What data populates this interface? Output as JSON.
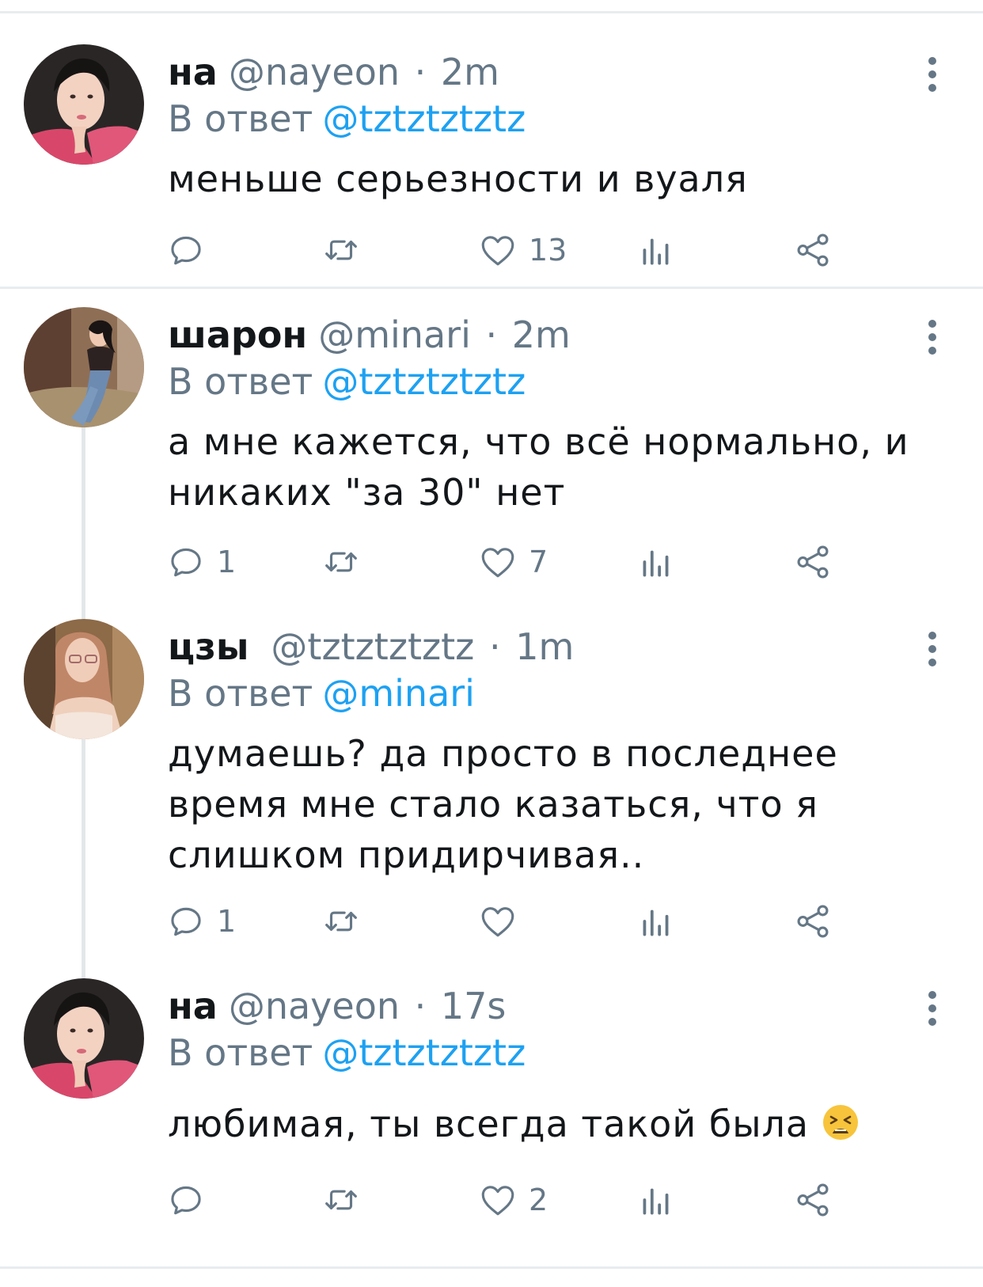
{
  "colors": {
    "accent": "#1da1f2",
    "secondary": "#657786",
    "text": "#14171a",
    "separator": "#e8ecef"
  },
  "tweets": [
    {
      "name": "на",
      "handle": "@nayeon",
      "dot": "·",
      "time": "2m",
      "reply_prefix": "В ответ",
      "reply_to": "@tztztztztz",
      "lines": [
        "меньше серьезности и вуаля"
      ],
      "reply_count": "",
      "retweet_count": "",
      "like_count": "13",
      "icons": {
        "reply": "reply-icon",
        "retweet": "retweet-icon",
        "like": "heart-icon",
        "stats": "analytics-icon",
        "share": "share-icon",
        "more": "more-vertical-icon"
      }
    },
    {
      "name": "шарон",
      "handle": "@minari",
      "dot": "·",
      "time": "2m",
      "reply_prefix": "В ответ",
      "reply_to": "@tztztztztz",
      "lines": [
        "а мне кажется, что всё нормально, и",
        "никаких \"за 30\" нет"
      ],
      "reply_count": "1",
      "retweet_count": "",
      "like_count": "7"
    },
    {
      "name": "цзы",
      "handle": "@tztztztztz",
      "dot": "·",
      "time": "1m",
      "reply_prefix": "В ответ",
      "reply_to": "@minari",
      "lines": [
        "думаешь? да просто в последнее",
        "время мне стало казаться, что я",
        "слишком придирчивая.."
      ],
      "reply_count": "1",
      "retweet_count": "",
      "like_count": ""
    },
    {
      "name": "на",
      "handle": "@nayeon",
      "dot": "·",
      "time": "17s",
      "reply_prefix": "В ответ",
      "reply_to": "@tztztztztz",
      "lines": [
        "любимая, ты всегда такой была"
      ],
      "emoji": "tired-face-emoji",
      "reply_count": "",
      "retweet_count": "",
      "like_count": "2"
    }
  ]
}
